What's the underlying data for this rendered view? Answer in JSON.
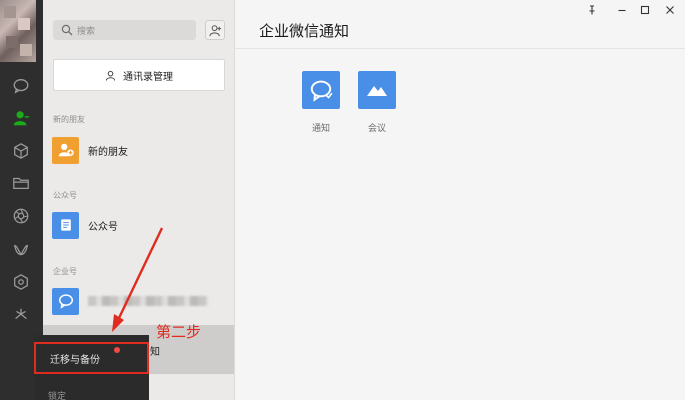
{
  "search": {
    "placeholder": "搜索"
  },
  "contacts": {
    "manage_label": "通讯录管理",
    "sections": {
      "new_friends_header": "新的朋友",
      "new_friends_item": "新的朋友",
      "official_header": "公众号",
      "official_item": "公众号",
      "enterprise_header": "企业号"
    },
    "partial_row_text": "知"
  },
  "popup": {
    "item_label": "迁移与备份",
    "item2_label": "锁定"
  },
  "annotation": {
    "text": "第二步",
    "color": "#e02b1f"
  },
  "main": {
    "title": "企业微信通知",
    "apps": [
      {
        "label": "通知",
        "icon": "chat-bubble-icon"
      },
      {
        "label": "会议",
        "icon": "meeting-mountain-icon"
      }
    ]
  },
  "colors": {
    "accent_blue": "#4a8fe7",
    "orange": "#f0a030",
    "rail_active_green": "#1aad19",
    "highlight_red": "#e02b1f"
  }
}
